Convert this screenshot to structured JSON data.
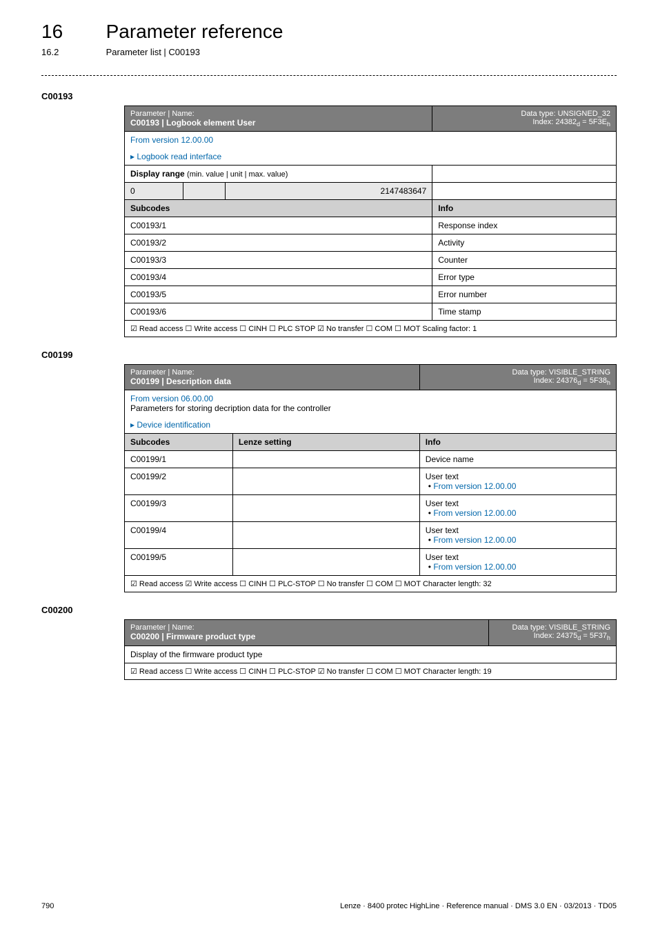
{
  "header": {
    "chapter_num": "16",
    "chapter_title": "Parameter reference",
    "section_num": "16.2",
    "section_title": "Parameter list | C00193"
  },
  "p193": {
    "heading": "C00193",
    "pn_label": "Parameter | Name:",
    "code_name": "C00193 | Logbook element User",
    "dtype": "Data type: UNSIGNED_32",
    "index": "Index: 24382",
    "index_sub_d": "d",
    "index_eq": " = 5F3E",
    "index_sub_h": "h",
    "from": "From version 12.00.00",
    "linkright": "Logbook read interface",
    "disp_range": "Display range (min. value | unit | max. value)",
    "min": "0",
    "mid": "",
    "max": "2147483647",
    "subcodes_hdr": "Subcodes",
    "info_hdr": "Info",
    "rows": [
      {
        "code": "C00193/1",
        "info": "Response index"
      },
      {
        "code": "C00193/2",
        "info": "Activity"
      },
      {
        "code": "C00193/3",
        "info": "Counter"
      },
      {
        "code": "C00193/4",
        "info": "Error type"
      },
      {
        "code": "C00193/5",
        "info": "Error number"
      },
      {
        "code": "C00193/6",
        "info": "Time stamp"
      }
    ],
    "access": "☑ Read access   ☐ Write access   ☐ CINH   ☐ PLC STOP   ☑ No transfer   ☐ COM   ☐ MOT    Scaling factor: 1"
  },
  "p199": {
    "heading": "C00199",
    "pn_label": "Parameter | Name:",
    "code_name": "C00199 | Description data",
    "dtype": "Data type: VISIBLE_STRING",
    "index": "Index: 24376",
    "index_sub_d": "d",
    "index_eq": " = 5F38",
    "index_sub_h": "h",
    "from": "From version 06.00.00",
    "desc": "Parameters for storing decription data for the controller",
    "linkright": "Device identification",
    "subcodes_hdr": "Subcodes",
    "lenze_hdr": "Lenze setting",
    "info_hdr": "Info",
    "rows": [
      {
        "code": "C00199/1",
        "info": "Device name",
        "extra": ""
      },
      {
        "code": "C00199/2",
        "info": "User text",
        "extra": "From version 12.00.00"
      },
      {
        "code": "C00199/3",
        "info": "User text",
        "extra": "From version 12.00.00"
      },
      {
        "code": "C00199/4",
        "info": "User text",
        "extra": "From version 12.00.00"
      },
      {
        "code": "C00199/5",
        "info": "User text",
        "extra": "From version 12.00.00"
      }
    ],
    "access": "☑ Read access   ☑ Write access   ☐ CINH   ☐ PLC-STOP   ☐ No transfer   ☐ COM   ☐ MOT    Character length: 32"
  },
  "p200": {
    "heading": "C00200",
    "pn_label": "Parameter | Name:",
    "code_name": "C00200 | Firmware product type",
    "dtype": "Data type: VISIBLE_STRING",
    "index": "Index: 24375",
    "index_sub_d": "d",
    "index_eq": " = 5F37",
    "index_sub_h": "h",
    "desc": "Display of the firmware product type",
    "access": "☑ Read access   ☐ Write access   ☐ CINH   ☐ PLC-STOP   ☑ No transfer   ☐ COM   ☐ MOT    Character length: 19"
  },
  "footer": {
    "page": "790",
    "doc": "Lenze · 8400 protec HighLine · Reference manual · DMS 3.0 EN · 03/2013 · TD05"
  }
}
